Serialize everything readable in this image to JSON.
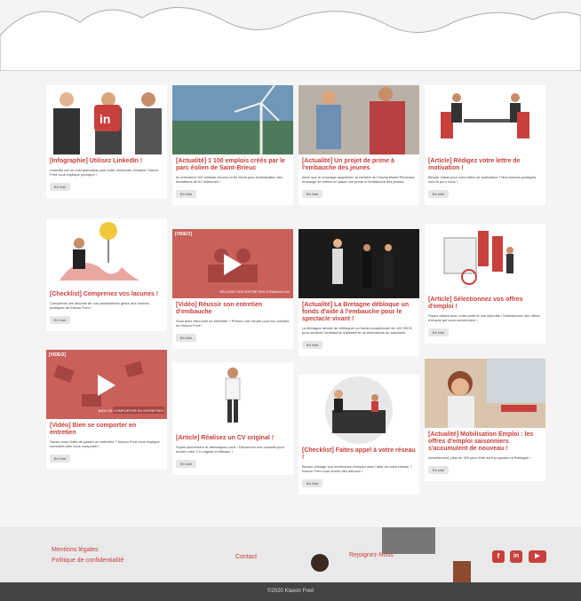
{
  "cards": [
    {
      "title": "[Infographie] Utilisez LinkedIn !",
      "desc": "LinkedIn est un outil primordial pour votre recherche d'emploi, Klaxon Fred vous explique pourquoi !",
      "btn": "En Voir"
    },
    {
      "title": "[Actualité] 1 100 emplois créés par le parc éolien de Saint-Brieuc",
      "desc": "Ils créeraient 100 millions d'euros et 82 siens pour la fabrication des fondations de 62 éoliennes !",
      "btn": "En Voir"
    },
    {
      "title": "[Actualité] Un projet de prime à l'embauche des jeunes",
      "desc": "Alors que le chômage augmente, la ministre du Travail Muriel Pénicaud envisage de mettre en place une prime à l'embauche des jeunes.",
      "btn": "En Voir"
    },
    {
      "title": "[Article] Rédigez votre lettre de motivation !",
      "desc": "Besoin d'aide pour votre lettre de motivation ? Nos bonnes pratiques sont là pour vous !",
      "btn": "En Voir"
    },
    {
      "title": "[Checklist] Comprenez vos lacunes !",
      "desc": "Comprenez les lacunes de vos candidatures grâce aux bonnes pratiques de Klaxon Fred !",
      "btn": "En Voir"
    },
    {
      "title": "[Vidéo] Réussir son entretien d'embauche",
      "desc": "Vous avez décroché un entretien ? Prenez une minute pour les conseils de Klaxon Fred !",
      "btn": "En Voir"
    },
    {
      "title": "[Actualité] La Bretagne débloque un fonds d'aide à l'embauche pour le spectacle vivant !",
      "desc": "La Bretagne décide de débloquer un fonds exceptionnel de 100 000 € pour soutenir l'embauche d'artistes et de techniciens du spectacle.",
      "btn": "En Voir"
    },
    {
      "title": "[Article] Sélectionnez vos offres d'emploi !",
      "desc": "Soyez ciblant avec votre profil et vos objectifs ! Sélectionnez des offres d'emploi qui vous conviennent !",
      "btn": "En Voir"
    },
    {
      "title": "[Vidéo] Bien se comporter en entretien",
      "desc": "Savez-vous l'idée de passer un entretien ? Klaxon Fred vous explique comment bien vous comporter !",
      "btn": "En Voir"
    },
    {
      "title": "[Article] Réalisez un CV original !",
      "desc": "Soyez accrocheur et démarquez-vous ! Découvrez nos conseils pour rendre votre CV original et efficace !",
      "btn": "En Voir"
    },
    {
      "title": "[Checklist] Faites appel à votre réseau !",
      "desc": "Besoin d'élargir vos recherches d'emploi avec l'aide de votre réseau ? Klaxon Fred vous donne des astuces !",
      "btn": "En Voir"
    },
    {
      "title": "[Actualité] Mobilisation Emploi : les offres d'emploi saisonniers s'accumulent de nouveau !",
      "desc": "Actuellement, plus de 300 jobs d'été sont proposés en Bretagne !",
      "btn": "En Voir"
    }
  ],
  "video_labels": {
    "tag": "[VIDEO]",
    "caption1": "RÉUSSIR SON ENTRETIEN D'EMBAUCHE",
    "caption2": "BIEN SE COMPORTER EN ENTRETIEN"
  },
  "footer": {
    "legal": "Mentions légales",
    "privacy": "Politique de confidentialité",
    "contact": "Contact",
    "join": "Rejoignez-Nous",
    "copyright": "©2020 Klaxon Fred"
  },
  "social": {
    "fb": "f",
    "in": "in",
    "yt": "▶"
  },
  "colors": {
    "accent": "#c8403c"
  }
}
